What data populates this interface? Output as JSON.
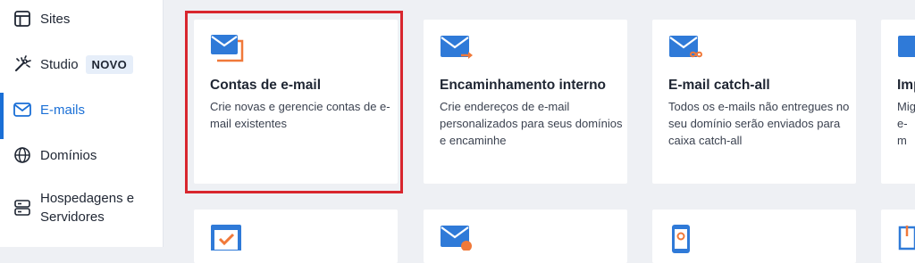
{
  "sidebar": {
    "items": [
      {
        "label": "Sites",
        "icon": "layout-icon"
      },
      {
        "label": "Studio",
        "icon": "wand-icon",
        "badge": "NOVO"
      },
      {
        "label": "E-mails",
        "icon": "mail-icon",
        "active": true
      },
      {
        "label": "Domínios",
        "icon": "globe-icon"
      },
      {
        "label": "Hospedagens e Servidores",
        "icon": "server-icon"
      }
    ]
  },
  "cards": [
    {
      "title": "Contas de e-mail",
      "description": "Crie novas e gerencie contas de e-mail existentes",
      "icon": "email-accounts-icon",
      "highlighted": true
    },
    {
      "title": "Encaminhamento interno",
      "description": "Crie endereços de e-mail personalizados para seus domínios e encaminhe",
      "icon": "email-forward-icon"
    },
    {
      "title": "E-mail catch-all",
      "description": "Todos os e-mails não entregues no seu domínio serão enviados para caixa catch-all",
      "icon": "email-catchall-icon"
    },
    {
      "title": "Imp",
      "description": "Mig e-m",
      "icon": "import-icon"
    }
  ],
  "bottom_cards": [
    {
      "icon": "checkbox-icon"
    },
    {
      "icon": "email-cancel-icon"
    },
    {
      "icon": "mobile-settings-icon"
    },
    {
      "icon": "download-icon"
    }
  ],
  "colors": {
    "accent": "#1a6fd6",
    "icon_blue": "#2f7ad8",
    "icon_orange": "#f0793a",
    "highlight_red": "#d8262e",
    "background": "#eef0f4"
  }
}
